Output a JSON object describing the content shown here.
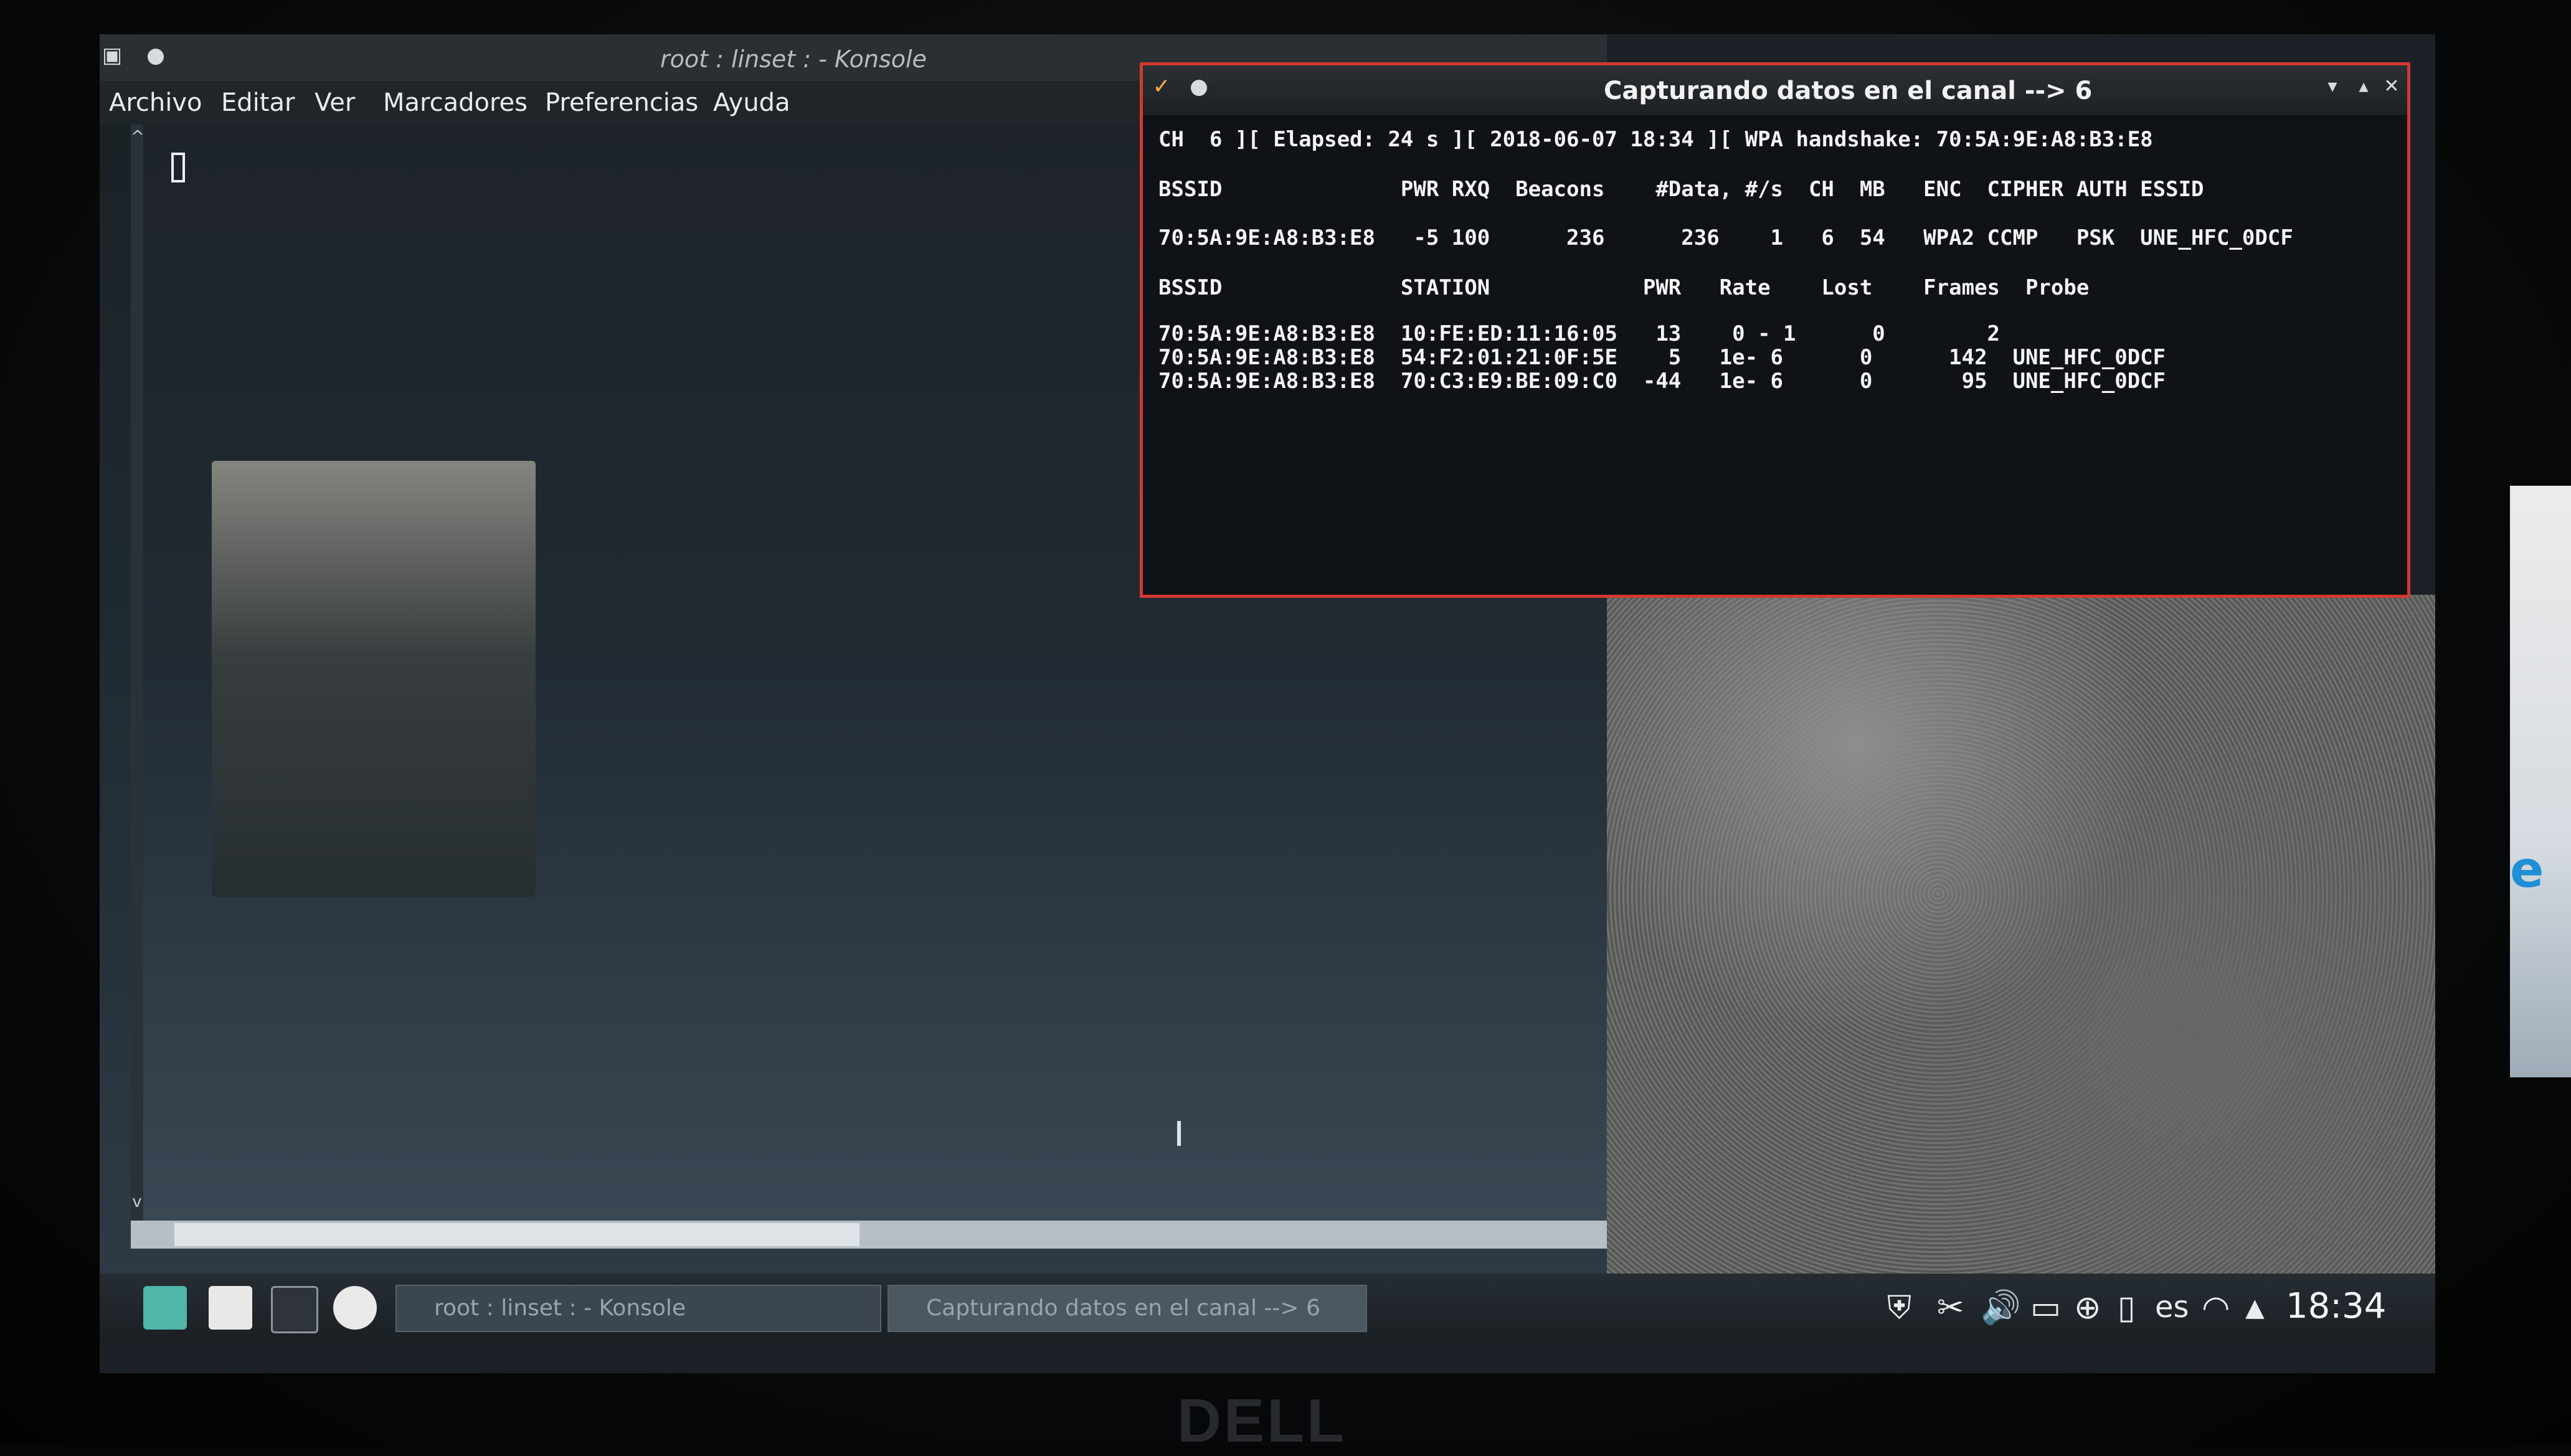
{
  "konsole": {
    "title": "root : linset : - Konsole",
    "menu": [
      "Archivo",
      "Editar",
      "Ver",
      "Marcadores",
      "Preferencias",
      "Ayuda"
    ],
    "tab_label": ""
  },
  "airodump": {
    "title": "Capturando datos en el canal --> 6",
    "status_line": "CH  6 ][ Elapsed: 24 s ][ 2018-06-07 18:34 ][ WPA handshake: 70:5A:9E:A8:B3:E8",
    "ap_header": "BSSID              PWR RXQ  Beacons    #Data, #/s  CH  MB   ENC  CIPHER AUTH ESSID",
    "ap_rows": [
      "70:5A:9E:A8:B3:E8   -5 100      236      236    1   6  54   WPA2 CCMP   PSK  UNE_HFC_0DCF"
    ],
    "station_header": "BSSID              STATION            PWR   Rate    Lost    Frames  Probe",
    "station_rows": [
      "70:5A:9E:A8:B3:E8  10:FE:ED:11:16:05   13    0 - 1      0        2",
      "70:5A:9E:A8:B3:E8  54:F2:01:21:0F:5E    5   1e- 6      0      142  UNE_HFC_0DCF",
      "70:5A:9E:A8:B3:E8  70:C3:E9:BE:09:C0  -44   1e- 6      0       95  UNE_HFC_0DCF"
    ]
  },
  "taskbar": {
    "tasks": [
      "root : linset : - Konsole",
      "Capturando datos en el canal --> 6"
    ],
    "language": "es",
    "clock": "18:34",
    "tray_icons": [
      "shield-icon",
      "scissors-icon",
      "volume-icon",
      "display-icon",
      "network-icon",
      "battery-icon",
      "wifi-icon",
      "arrow-up-icon"
    ]
  },
  "bezel": {
    "brand": "DELL"
  },
  "colors": {
    "accent_border": "#d3382f",
    "terminal_bg": "#0f1317",
    "terminal_fg": "#f4f4f4"
  }
}
